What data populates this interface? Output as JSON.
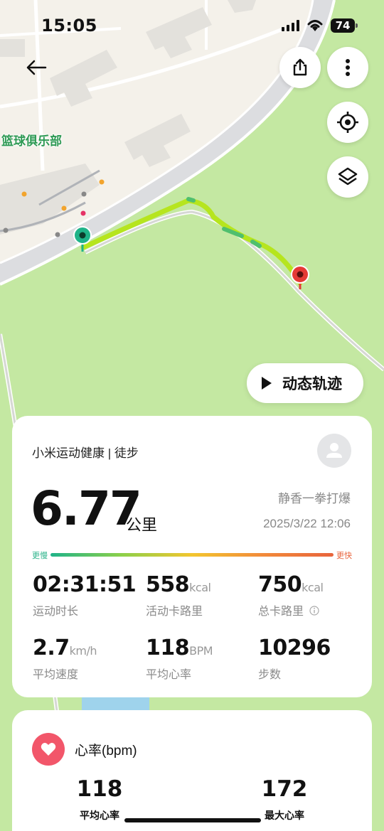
{
  "status_bar": {
    "time": "15:05",
    "battery": "74"
  },
  "map": {
    "place_label": "篮球俱乐部"
  },
  "replay_button": {
    "label": "动态轨迹"
  },
  "summary": {
    "source": "小米运动健康 | 徒步",
    "distance": "6.77",
    "distance_unit": "公里",
    "user_name": "静香一拳打爆",
    "date": "2025/3/22 12:06",
    "pace_slow_label": "更慢",
    "pace_fast_label": "更快",
    "stats": [
      {
        "value": "02:31:51",
        "unit": "",
        "label": "运动时长"
      },
      {
        "value": "558",
        "unit": "kcal",
        "label": "活动卡路里"
      },
      {
        "value": "750",
        "unit": "kcal",
        "label": "总卡路里"
      },
      {
        "value": "2.7",
        "unit": "km/h",
        "label": "平均速度"
      },
      {
        "value": "118",
        "unit": "BPM",
        "label": "平均心率"
      },
      {
        "value": "10296",
        "unit": "",
        "label": "步数"
      }
    ]
  },
  "heart_rate": {
    "title": "心率(bpm)",
    "avg_value": "118",
    "avg_label": "平均心率",
    "max_value": "172",
    "max_label": "最大心率"
  },
  "colors": {
    "accent_green": "#1fb389",
    "heart_red": "#f2566a",
    "route": "#b6e51e",
    "end_pin": "#e53935"
  },
  "icons": [
    "back-arrow-icon",
    "share-icon",
    "more-icon",
    "locate-icon",
    "layers-icon",
    "play-icon",
    "avatar-icon",
    "info-icon",
    "heart-icon"
  ]
}
